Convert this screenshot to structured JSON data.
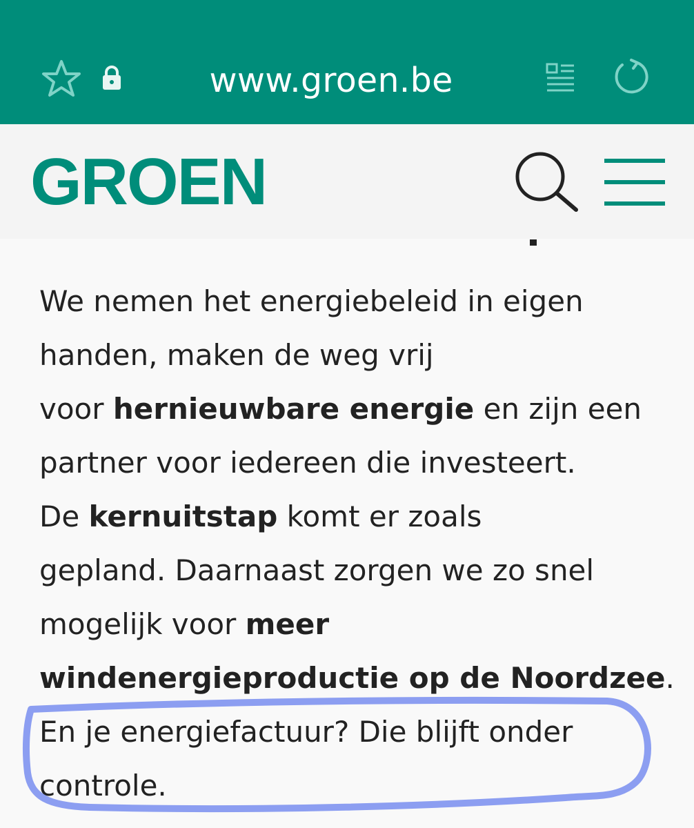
{
  "browser": {
    "url": "www.groen.be",
    "icons": [
      "star-icon",
      "lock-icon",
      "reader-mode-icon",
      "reload-icon"
    ],
    "bar_color": "#008d7a"
  },
  "header": {
    "logo_text": "GROEN",
    "icons": [
      "search-icon",
      "menu-icon"
    ],
    "brand_color": "#008d7a"
  },
  "article": {
    "line1": "We nemen het energiebeleid in eigen",
    "line2": "handen, maken de weg vrij",
    "line3_pre": "voor ",
    "line3_bold": "hernieuwbare energie",
    "line3_post": " en zijn een",
    "line4": "partner voor iedereen die investeert.",
    "line5_pre": "De ",
    "line5_bold": "kernuitstap",
    "line5_post": " komt er zoals",
    "line6": "gepland. Daarnaast zorgen we zo snel",
    "line7_pre": "mogelijk voor ",
    "line7_bold": "meer",
    "line8_bold": "windenergieproductie op de Noordzee",
    "line8_post": ".",
    "line9": "En je energiefactuur? Die blijft onder",
    "line10": "controle."
  },
  "annotation": {
    "color": "#7f93f0"
  }
}
